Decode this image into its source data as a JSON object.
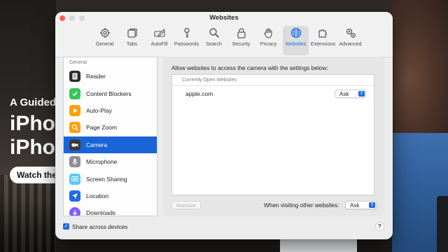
{
  "background": {
    "headline_small": "A Guided",
    "headline_line1": "iPho",
    "headline_line2": "iPho",
    "watch_button": "Watch the f"
  },
  "window": {
    "title": "Websites",
    "toolbar": [
      {
        "label": "General",
        "icon": "gear-icon"
      },
      {
        "label": "Tabs",
        "icon": "tabs-icon"
      },
      {
        "label": "AutoFill",
        "icon": "pencil-icon"
      },
      {
        "label": "Passwords",
        "icon": "key-icon"
      },
      {
        "label": "Search",
        "icon": "magnifier-icon"
      },
      {
        "label": "Security",
        "icon": "lock-icon"
      },
      {
        "label": "Privacy",
        "icon": "hand-icon"
      },
      {
        "label": "Websites",
        "icon": "globe-icon",
        "selected": true
      },
      {
        "label": "Extensions",
        "icon": "puzzle-icon"
      },
      {
        "label": "Advanced",
        "icon": "gears-icon"
      }
    ],
    "sidebar": {
      "section_header": "General",
      "items": [
        {
          "label": "Reader",
          "icon": "reader-icon",
          "color": "#2b2b2b"
        },
        {
          "label": "Content Blockers",
          "icon": "checkmark-shield-icon",
          "color": "#34c759"
        },
        {
          "label": "Auto-Play",
          "icon": "play-icon",
          "color": "#ff9f0a"
        },
        {
          "label": "Page Zoom",
          "icon": "zoom-icon",
          "color": "#ff9f0a"
        },
        {
          "label": "Camera",
          "icon": "camera-icon",
          "color": "#3a3a3c",
          "active": true
        },
        {
          "label": "Microphone",
          "icon": "microphone-icon",
          "color": "#8e8e93"
        },
        {
          "label": "Screen Sharing",
          "icon": "screen-sharing-icon",
          "color": "#5ac8fa"
        },
        {
          "label": "Location",
          "icon": "location-arrow-icon",
          "color": "#1f6be0"
        },
        {
          "label": "Downloads",
          "icon": "download-icon",
          "color": "#7d5fff"
        }
      ]
    },
    "main": {
      "description": "Allow websites to access the camera with the settings below:",
      "list_header": "Currently Open Websites",
      "websites": [
        {
          "site": "apple.com",
          "setting": "Ask"
        }
      ],
      "remove_label": "Remove",
      "other_label": "When visiting other websites:",
      "other_setting": "Ask"
    },
    "footer": {
      "share_label": "Share across devices",
      "share_checked": true,
      "help_label": "?"
    }
  }
}
